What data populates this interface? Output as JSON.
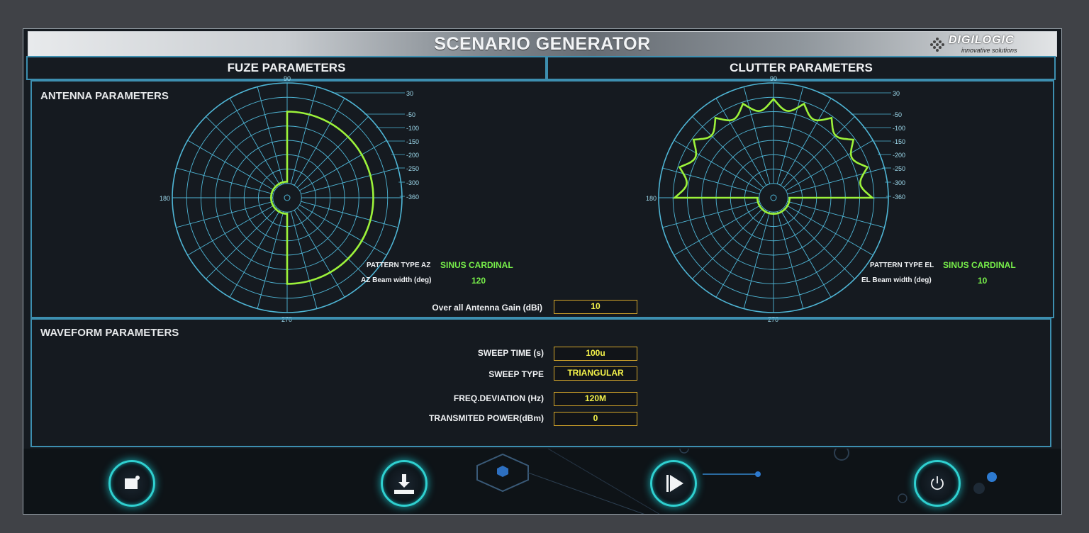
{
  "app": {
    "title": "SCENARIO GENERATOR",
    "logo_text": "DIGILOGIC",
    "logo_tagline": "innovative solutions"
  },
  "tabs": [
    {
      "label": "FUZE PARAMETERS"
    },
    {
      "label": "CLUTTER PARAMETERS"
    }
  ],
  "antenna": {
    "title": "ANTENNA PARAMETERS",
    "polar_labels": {
      "angles": [
        "90",
        "180",
        "270"
      ],
      "rings": [
        "30",
        "-50",
        "-100",
        "-150",
        "-200",
        "-250",
        "-300",
        "-360"
      ]
    },
    "az": {
      "pattern_label": "PATTERN TYPE AZ",
      "pattern_value": "SINUS CARDINAL",
      "beam_label": "AZ Beam width (deg)",
      "beam_value": "120"
    },
    "el": {
      "pattern_label": "PATTERN TYPE  EL",
      "pattern_value": "SINUS CARDINAL",
      "beam_label": "EL Beam width (deg)",
      "beam_value": "10"
    },
    "gain_label": "Over all Antenna Gain (dBi)",
    "gain_value": "10"
  },
  "waveform": {
    "title": "WAVEFORM PARAMETERS",
    "sweep_time_label": "SWEEP TIME (s)",
    "sweep_time_value": "100u",
    "sweep_type_label": "SWEEP TYPE",
    "sweep_type_value": "TRIANGULAR",
    "freq_dev_label": "FREQ.DEVIATION (Hz)",
    "freq_dev_value": "120M",
    "tx_power_label": "TRANSMITED POWER(dBm)",
    "tx_power_value": "0"
  },
  "colors": {
    "accent": "#2fd0d0",
    "panel_border": "#3d8fb0",
    "grid": "#4fb6d6",
    "pattern": "#9cf23a",
    "value_green": "#78f04a",
    "field_border": "#d4a62a",
    "field_text": "#f4f24a"
  },
  "buttons": [
    {
      "icon": "new-file-icon"
    },
    {
      "icon": "download-icon"
    },
    {
      "icon": "play-icon"
    },
    {
      "icon": "power-icon"
    }
  ]
}
